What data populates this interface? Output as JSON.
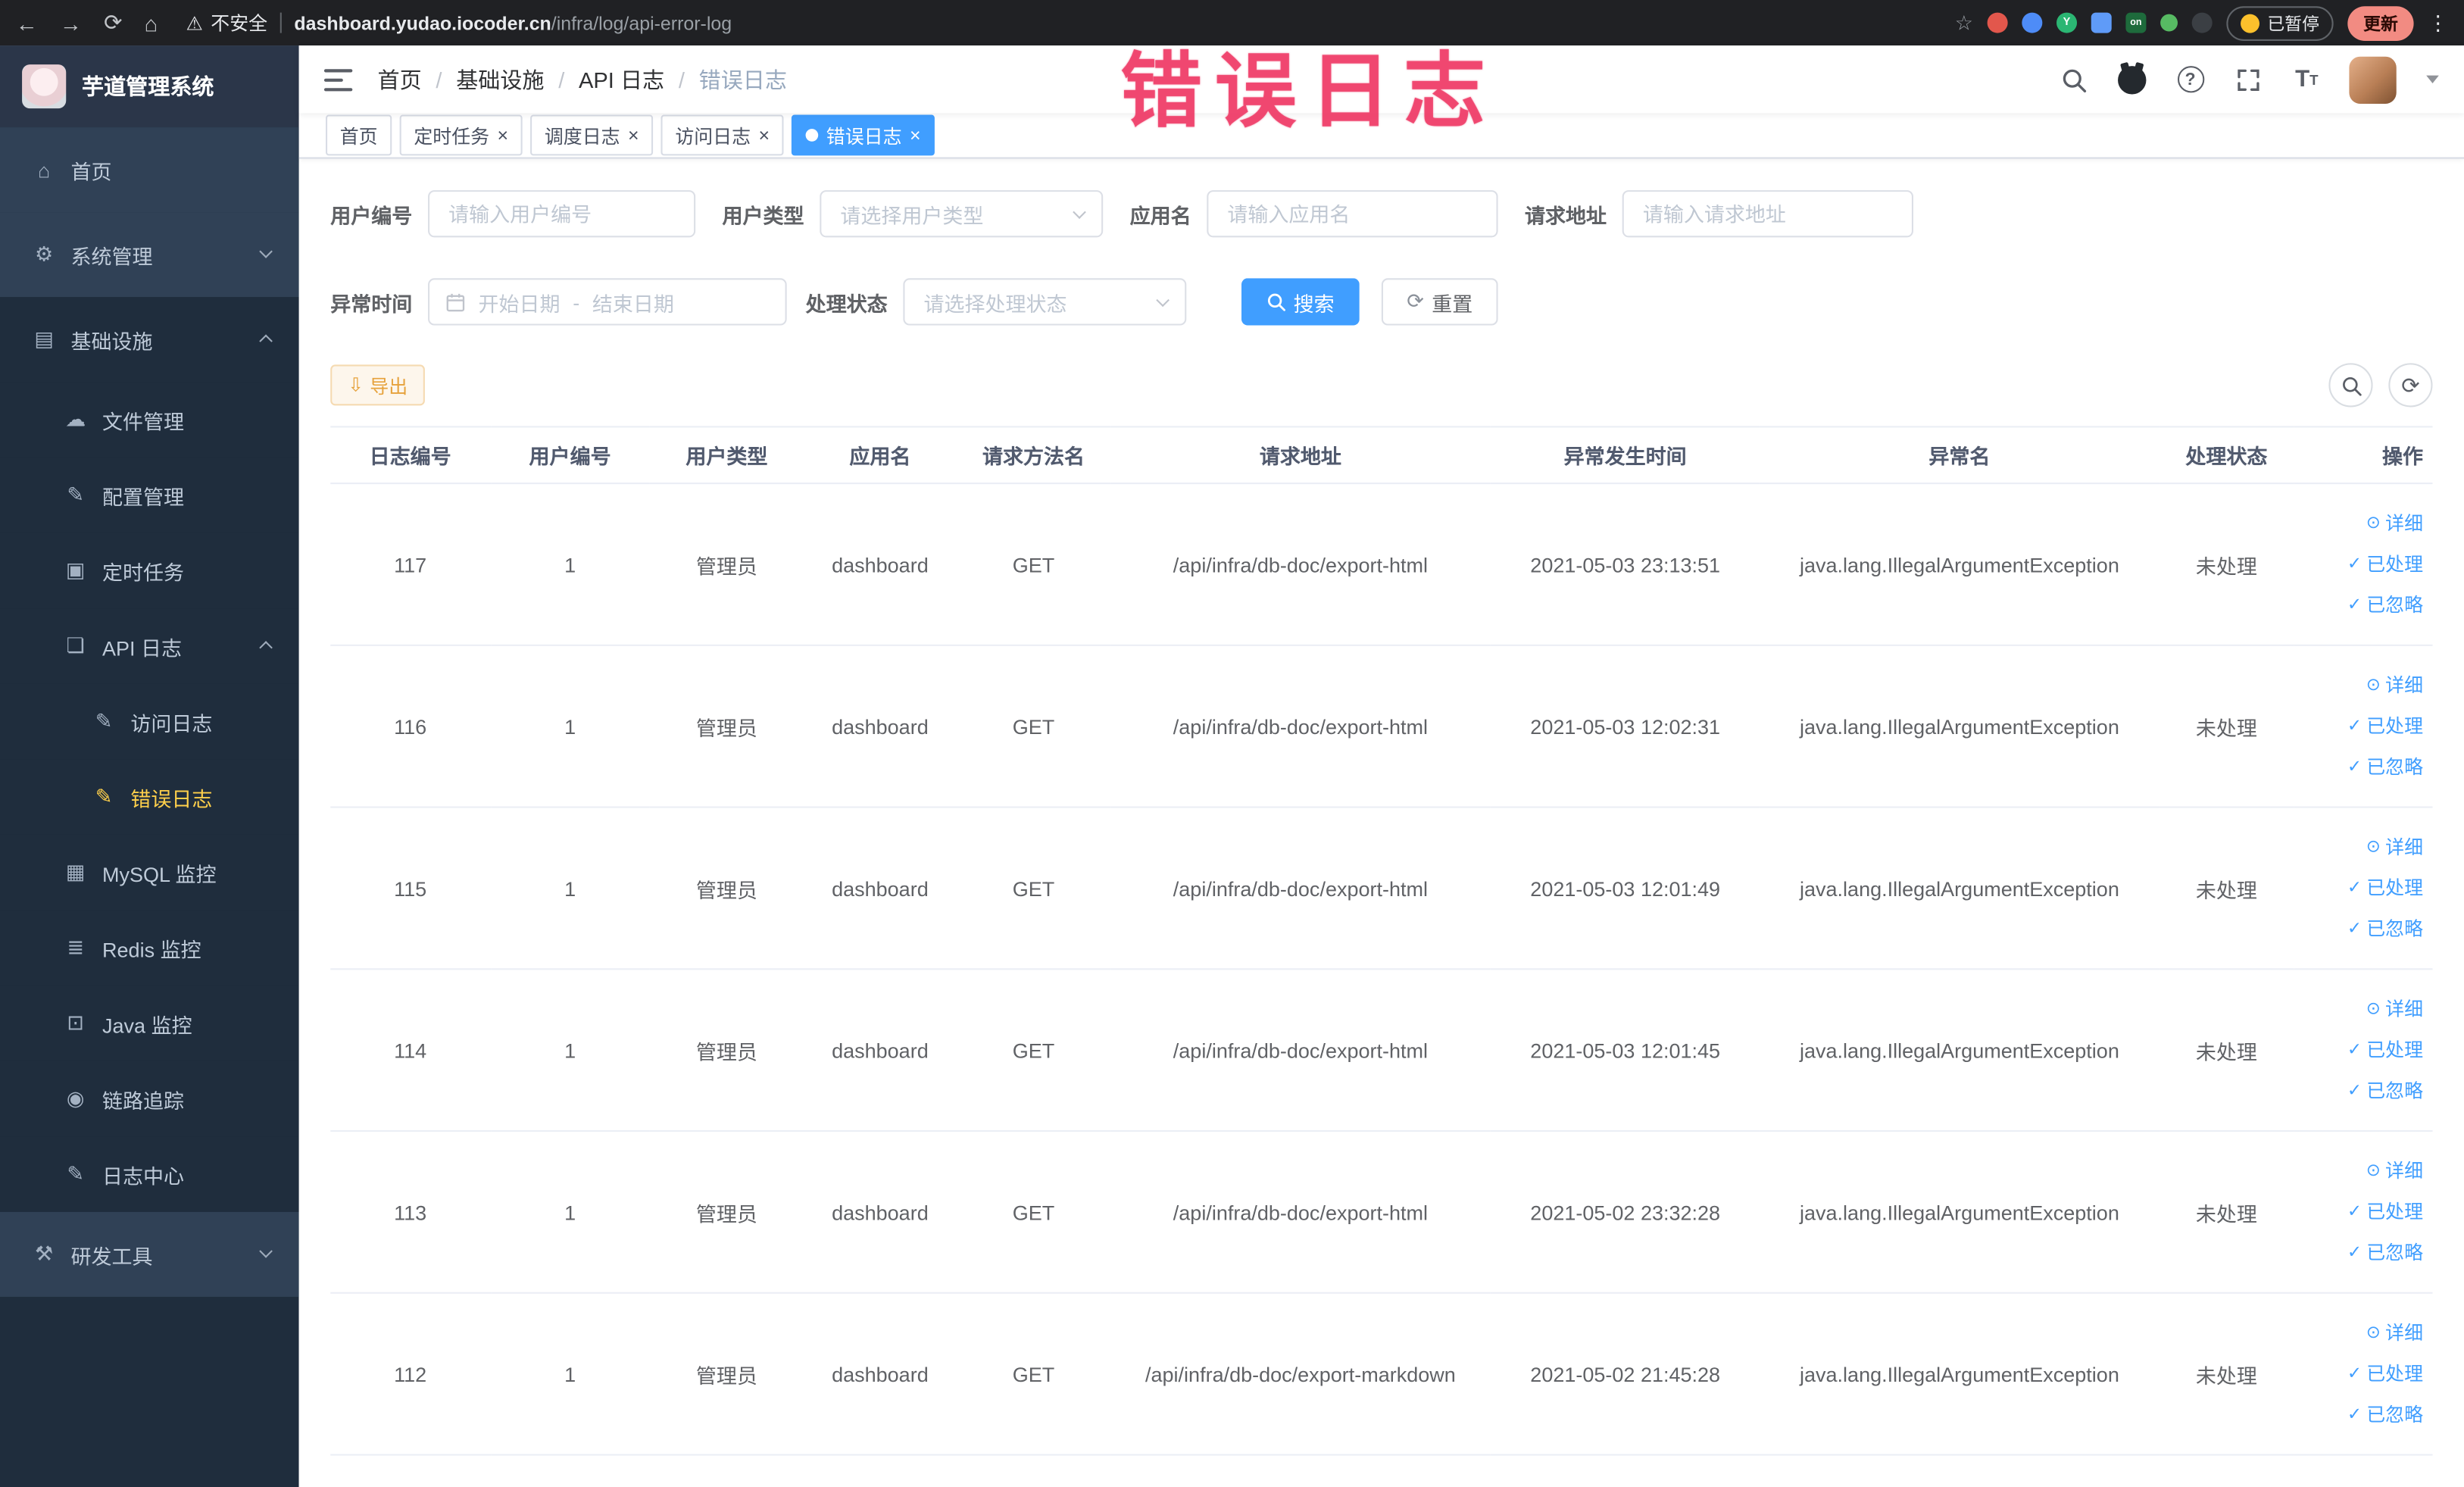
{
  "browser": {
    "security_label": "不安全",
    "url_host": "dashboard.yudao.iocoder.cn",
    "url_path": "/infra/log/api-error-log",
    "paused_badge": "已暂停",
    "update_button": "更新",
    "ext_on_label": "on",
    "ext_y_label": "Y"
  },
  "icons": {
    "back": "←",
    "forward": "→",
    "reload": "⟳",
    "home": "⌂",
    "warning": "⚠",
    "star": "☆",
    "menu_dots": "⋮",
    "question": "?",
    "close": "×",
    "check": "✓",
    "eye": "⊙",
    "download": "⇩",
    "refresh": "⟳",
    "textsize": "T"
  },
  "annotation": {
    "text": "错误日志"
  },
  "sidebar": {
    "logo_title": "芋道管理系统",
    "items": [
      {
        "label": "首页",
        "icon": "⌂"
      },
      {
        "label": "系统管理",
        "icon": "⚙"
      },
      {
        "label": "基础设施",
        "icon": "▤"
      },
      {
        "label": "文件管理",
        "icon": "☁"
      },
      {
        "label": "配置管理",
        "icon": "✎"
      },
      {
        "label": "定时任务",
        "icon": "▣"
      },
      {
        "label": "API 日志",
        "icon": "❏"
      },
      {
        "label": "访问日志",
        "icon": "✎"
      },
      {
        "label": "错误日志",
        "icon": "✎"
      },
      {
        "label": "MySQL 监控",
        "icon": "▦"
      },
      {
        "label": "Redis 监控",
        "icon": "≣"
      },
      {
        "label": "Java 监控",
        "icon": "⊡"
      },
      {
        "label": "链路追踪",
        "icon": "◉"
      },
      {
        "label": "日志中心",
        "icon": "✎"
      },
      {
        "label": "研发工具",
        "icon": "⚒"
      }
    ]
  },
  "breadcrumb": {
    "items": [
      "首页",
      "基础设施",
      "API 日志",
      "错误日志"
    ],
    "separator": "/"
  },
  "tabs": [
    {
      "label": "首页"
    },
    {
      "label": "定时任务"
    },
    {
      "label": "调度日志"
    },
    {
      "label": "访问日志"
    },
    {
      "label": "错误日志"
    }
  ],
  "filters": {
    "user_id": {
      "label": "用户编号",
      "placeholder": "请输入用户编号"
    },
    "user_type": {
      "label": "用户类型",
      "placeholder": "请选择用户类型"
    },
    "app_name": {
      "label": "应用名",
      "placeholder": "请输入应用名"
    },
    "request_url": {
      "label": "请求地址",
      "placeholder": "请输入请求地址"
    },
    "exception_time": {
      "label": "异常时间",
      "start_placeholder": "开始日期",
      "separator": "-",
      "end_placeholder": "结束日期"
    },
    "process_status": {
      "label": "处理状态",
      "placeholder": "请选择处理状态"
    },
    "search_label": "搜索",
    "reset_label": "重置"
  },
  "toolbar": {
    "export_label": "导出"
  },
  "table": {
    "columns": [
      "日志编号",
      "用户编号",
      "用户类型",
      "应用名",
      "请求方法名",
      "请求地址",
      "异常发生时间",
      "异常名",
      "处理状态",
      "操作"
    ],
    "actions": {
      "detail": "详细",
      "processed": "已处理",
      "ignored": "已忽略"
    },
    "rows": [
      {
        "id": "117",
        "user_id": "1",
        "user_type": "管理员",
        "app": "dashboard",
        "method": "GET",
        "url": "/api/infra/db-doc/export-html",
        "time": "2021-05-03 23:13:51",
        "exception": "java.lang.IllegalArgumentException",
        "status": "未处理"
      },
      {
        "id": "116",
        "user_id": "1",
        "user_type": "管理员",
        "app": "dashboard",
        "method": "GET",
        "url": "/api/infra/db-doc/export-html",
        "time": "2021-05-03 12:02:31",
        "exception": "java.lang.IllegalArgumentException",
        "status": "未处理"
      },
      {
        "id": "115",
        "user_id": "1",
        "user_type": "管理员",
        "app": "dashboard",
        "method": "GET",
        "url": "/api/infra/db-doc/export-html",
        "time": "2021-05-03 12:01:49",
        "exception": "java.lang.IllegalArgumentException",
        "status": "未处理"
      },
      {
        "id": "114",
        "user_id": "1",
        "user_type": "管理员",
        "app": "dashboard",
        "method": "GET",
        "url": "/api/infra/db-doc/export-html",
        "time": "2021-05-03 12:01:45",
        "exception": "java.lang.IllegalArgumentException",
        "status": "未处理"
      },
      {
        "id": "113",
        "user_id": "1",
        "user_type": "管理员",
        "app": "dashboard",
        "method": "GET",
        "url": "/api/infra/db-doc/export-html",
        "time": "2021-05-02 23:32:28",
        "exception": "java.lang.IllegalArgumentException",
        "status": "未处理"
      },
      {
        "id": "112",
        "user_id": "1",
        "user_type": "管理员",
        "app": "dashboard",
        "method": "GET",
        "url": "/api/infra/db-doc/export-markdown",
        "time": "2021-05-02 21:45:28",
        "exception": "java.lang.IllegalArgumentException",
        "status": "未处理"
      }
    ]
  },
  "colors": {
    "primary": "#409eff",
    "warning_text": "#e6a23c",
    "sidebar_active": "#ffd04b",
    "annotation": "#ee3462",
    "link": "#409eff"
  }
}
